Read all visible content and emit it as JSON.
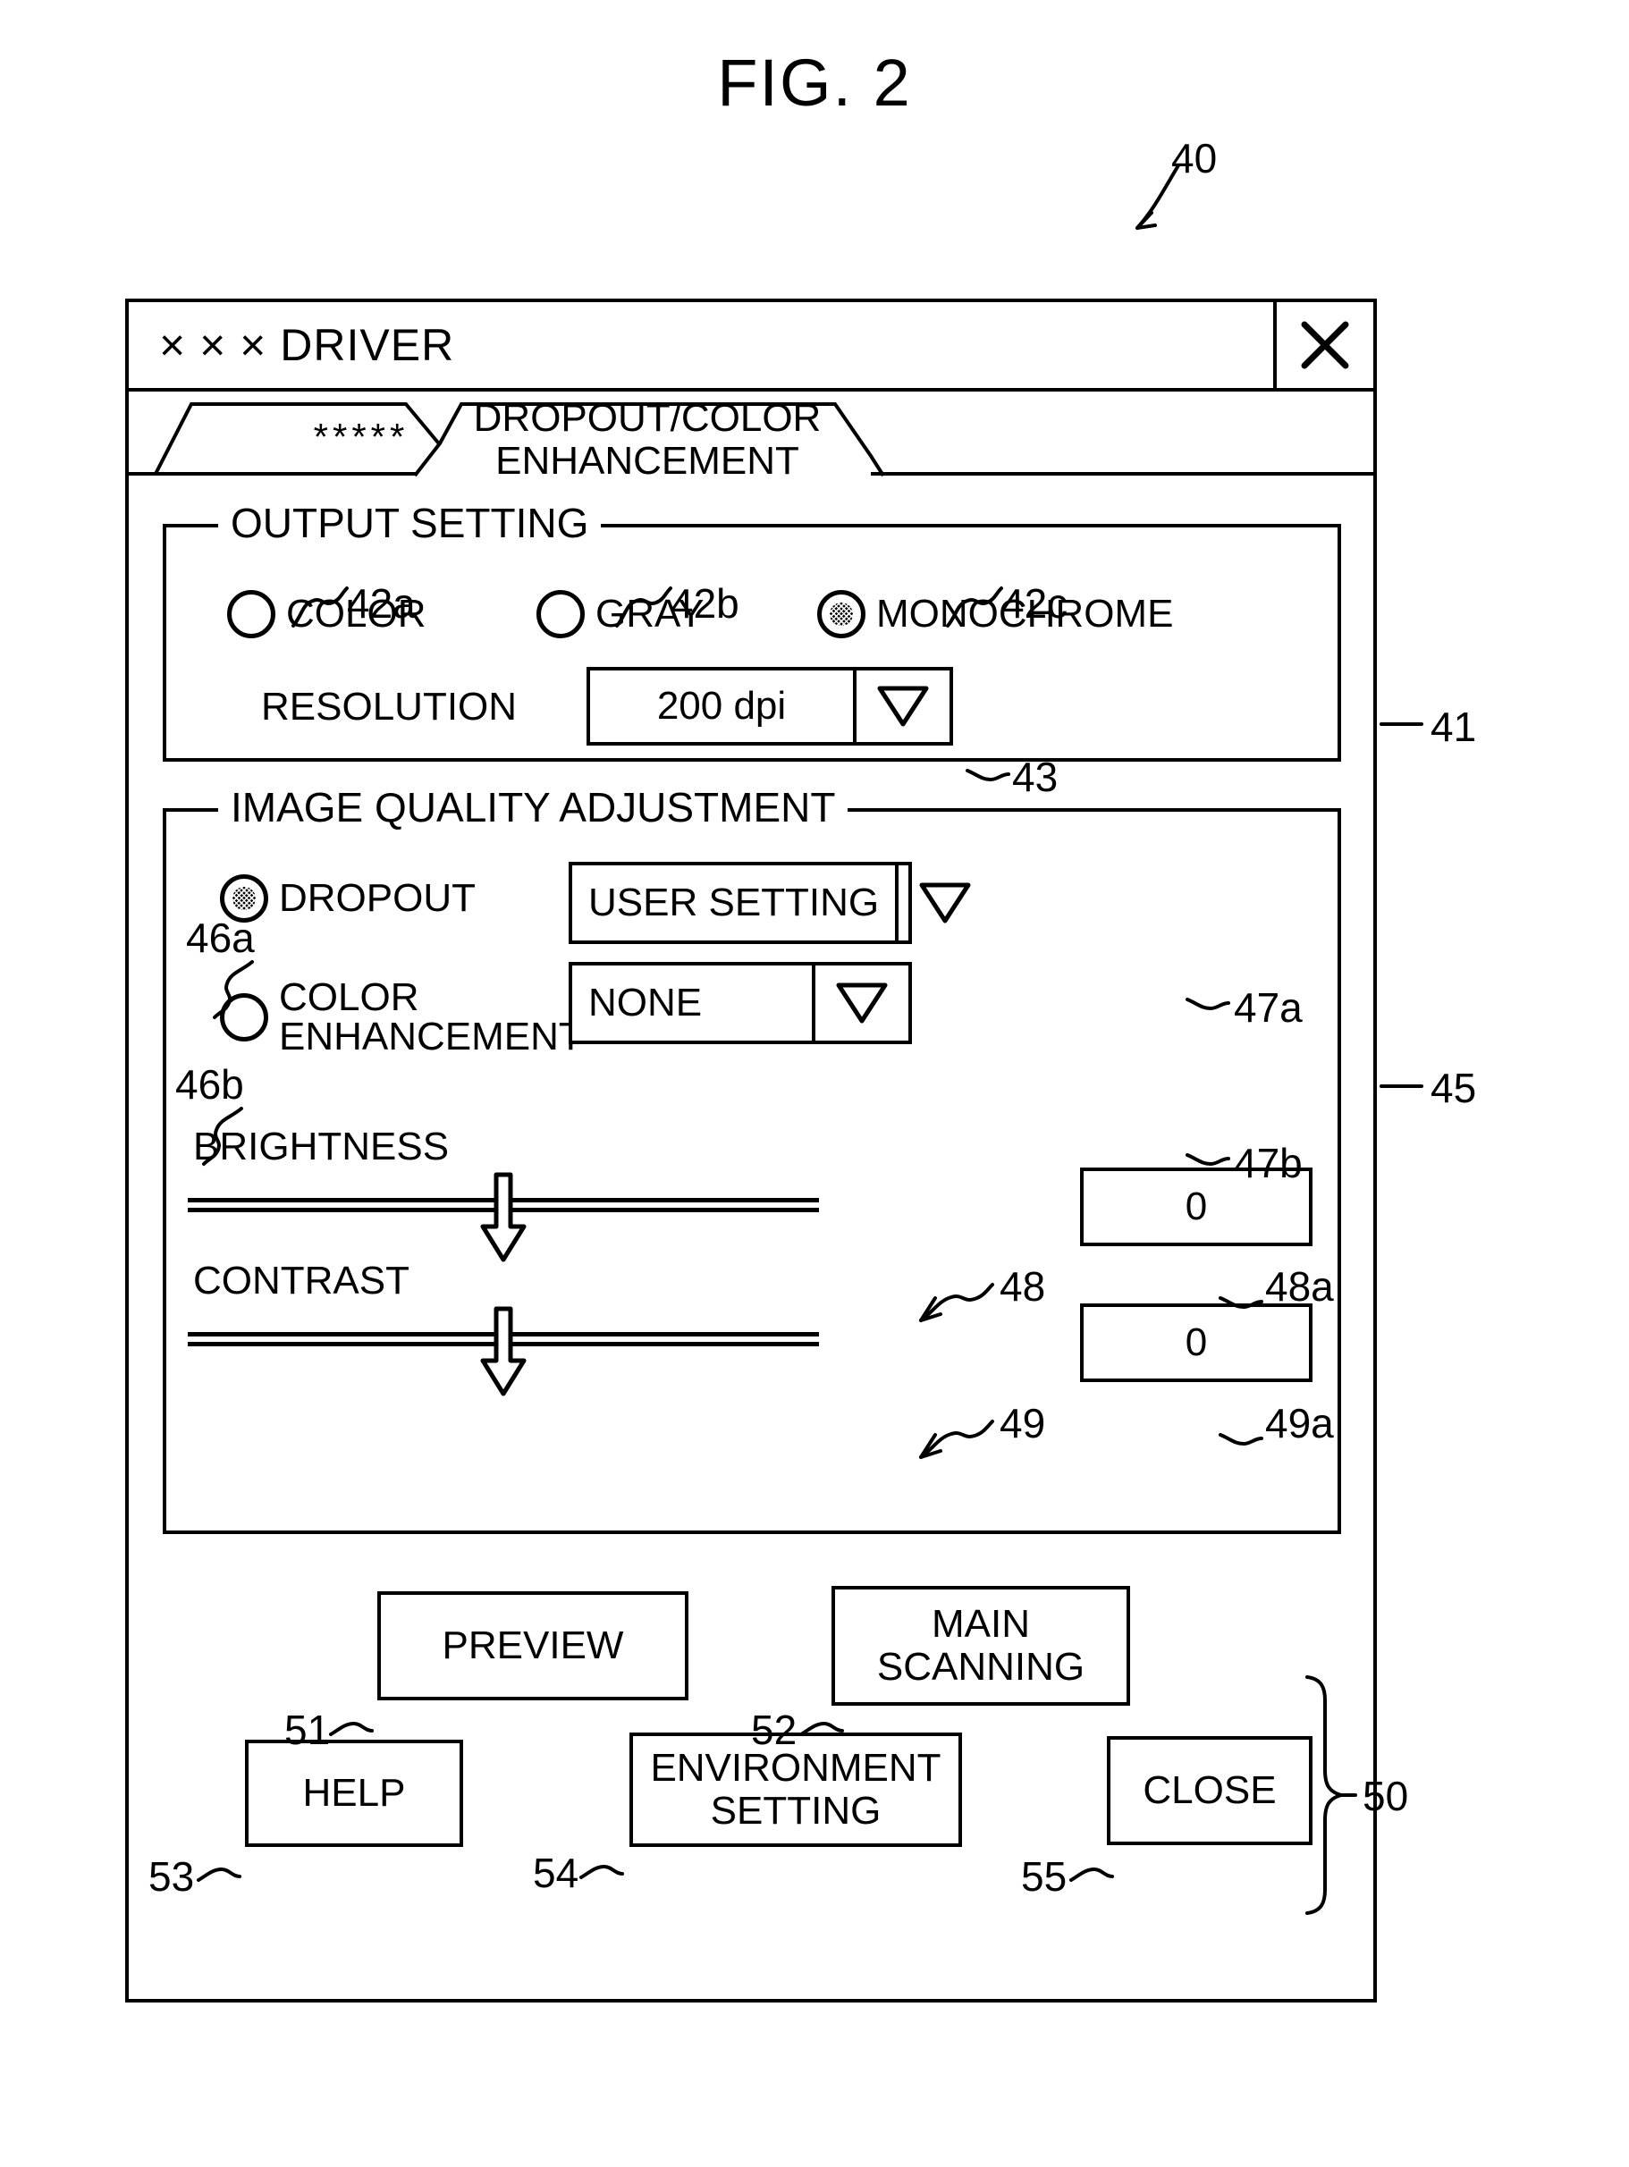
{
  "figure": {
    "title": "FIG. 2",
    "callout_main": "40"
  },
  "window": {
    "title": "× × × DRIVER",
    "close_icon": "close-x-icon"
  },
  "tabs": [
    {
      "label": "*****",
      "selected": false
    },
    {
      "label": "DROPOUT/COLOR ENHANCEMENT",
      "selected": true
    }
  ],
  "output_setting": {
    "legend": "OUTPUT SETTING",
    "callout": "41",
    "modes": [
      {
        "label": "COLOR",
        "callout": "42a",
        "checked": false
      },
      {
        "label": "GRAY",
        "callout": "42b",
        "checked": false
      },
      {
        "label": "MONOCHROME",
        "callout": "42c",
        "checked": true
      }
    ],
    "resolution": {
      "label": "RESOLUTION",
      "value": "200 dpi",
      "callout": "43",
      "dropdown_icon": "triangle-down-icon"
    }
  },
  "image_quality": {
    "legend": "IMAGE QUALITY ADJUSTMENT",
    "callout": "45",
    "options": [
      {
        "label": "DROPOUT",
        "callout": "46a",
        "checked": true,
        "select_value": "USER SETTING",
        "select_callout": "47a",
        "dropdown_icon": "triangle-down-icon"
      },
      {
        "label": "COLOR ENHANCEMENT",
        "callout": "46b",
        "checked": false,
        "select_value": "NONE",
        "select_callout": "47b",
        "dropdown_icon": "triangle-down-icon"
      }
    ],
    "sliders": [
      {
        "label": "BRIGHTNESS",
        "callout": "48",
        "value": "0",
        "value_callout": "48a",
        "position_percent": 50,
        "thumb_icon": "arrow-down-thumb-icon"
      },
      {
        "label": "CONTRAST",
        "callout": "49",
        "value": "0",
        "value_callout": "49a",
        "position_percent": 50,
        "thumb_icon": "arrow-down-thumb-icon"
      }
    ]
  },
  "buttons": {
    "group_callout": "50",
    "items": [
      {
        "label": "PREVIEW",
        "callout": "51"
      },
      {
        "label": "MAIN SCANNING",
        "callout": "52"
      },
      {
        "label": "HELP",
        "callout": "53"
      },
      {
        "label": "ENVIRONMENT SETTING",
        "callout": "54"
      },
      {
        "label": "CLOSE",
        "callout": "55"
      }
    ]
  }
}
